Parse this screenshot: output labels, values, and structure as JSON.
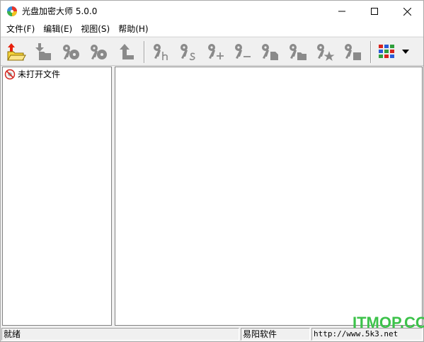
{
  "window": {
    "title": "光盘加密大师 5.0.0"
  },
  "menu": [
    {
      "label": "文件(F)"
    },
    {
      "label": "编辑(E)"
    },
    {
      "label": "视图(S)"
    },
    {
      "label": "帮助(H)"
    }
  ],
  "toolbar": {
    "buttons": [
      {
        "icon": "open-folder-icon",
        "enabled": true
      },
      {
        "icon": "save-icon",
        "enabled": false
      },
      {
        "icon": "key-disc-icon",
        "enabled": false
      },
      {
        "icon": "key-disc-2-icon",
        "enabled": false
      },
      {
        "icon": "up-level-icon",
        "enabled": false
      },
      {
        "icon": "key-h-icon",
        "enabled": false
      },
      {
        "icon": "key-s-icon",
        "enabled": false
      },
      {
        "icon": "key-plus-icon",
        "enabled": false
      },
      {
        "icon": "key-minus-icon",
        "enabled": false
      },
      {
        "icon": "key-file-icon",
        "enabled": false
      },
      {
        "icon": "key-folder-icon",
        "enabled": false
      },
      {
        "icon": "key-star-icon",
        "enabled": false
      },
      {
        "icon": "key-block-icon",
        "enabled": false
      },
      {
        "icon": "view-grid-icon",
        "enabled": true
      },
      {
        "icon": "dropdown-arrow-icon",
        "enabled": true
      }
    ]
  },
  "tree": {
    "root_label": "未打开文件"
  },
  "status": {
    "left": "就绪",
    "middle": "易阳软件",
    "right": "http://www.5k3.net"
  },
  "watermark": "ITMOP.COM",
  "colors": {
    "disabled_icon": "#8a8a8a",
    "watermark": "#3cc24a",
    "open_arrow": "#e8200c",
    "folder": "#f5d33a"
  }
}
